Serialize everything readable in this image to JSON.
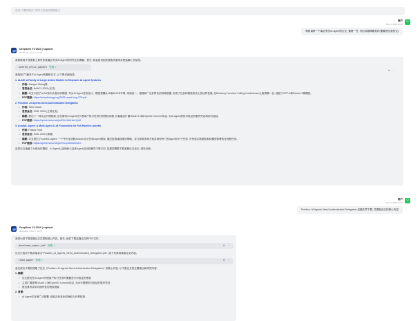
{
  "top_input": {
    "placeholder": "说说, 问题和指令, 按可以在使用搜索能力"
  },
  "conversation": {
    "user1": {
      "name": "用户",
      "time": "Nov 3, 2025 11:24",
      "message": "帮我调研一下最近有关AI agent的论文, 要看一些, 列出标题摘要就好(需要提交我的论)"
    },
    "ai1": {
      "name": "DeepSeek V3 0324 | sophnet",
      "time": "deepseek • Nov 3, 11:24",
      "intro": "我将使用开放搜索工具来查找最近有关AI Agent的研究论文摘要。首先, 我会尝试相关搜索关键词并把结果汇总给您。",
      "tool": {
        "name": "search_arxiv_papers",
        "status": "完成 ✓"
      },
      "results_intro": "我找到了3篇关于AI Agent的最新论文, 以下是详细信息:",
      "papers": [
        {
          "title": "1. aLAM: A Family of Large Action Models to Empower AI Agent Systems",
          "author_label": "作者:",
          "author": "Jianguo Zhang等",
          "venue_label": "发表会议:",
          "venue": "NAACL 2025 (长文)",
          "abstract_label": "摘要:",
          "abstract": "本文介绍了xLAM系列大型动作模型, 专为AI Agent任务设计。模型规模从1B到8x22B不等, 采用统一、增强和广泛多样化的训练数据, 实现了在多种基准测试上的优异性能, 在Berkeley Function-Calling Leaderboard上取得第一名, 超越了GPT-4和Claude-3等模型。",
          "link_label": "PDF链接:",
          "link": "https://aclanthology.org/2025.naacl-long.378.pdf"
        },
        {
          "title": "2. Position: AI Agents Need Authenticated Delegation",
          "author_label": "作者:",
          "author": "Tobin South",
          "venue_label": "发表会议:",
          "venue": "ICML 2025 (立场论文)",
          "abstract_label": "摘要:",
          "abstract": "提出了一种认证代理框架, 旨在解决AI Agent在代表用户执行任务时的授权问题, 作者建议扩展OAuth 2.0和OpenID Connect协议, 为AI Agent提供可验证的委托凭证和访问控制。",
          "link_label": "PDF链接:",
          "link": "https://openreview.net/pdf?id=9skHxuHyrM"
        },
        {
          "title": "3. AutoML-Agent: A Multi-Agent LLM Framework for Full-Pipeline AutoML",
          "author_label": "作者:",
          "author": "Patara Trirat",
          "venue_label": "发表会议:",
          "venue": "ICML 2025 (海报)",
          "abstract_label": "摘要:",
          "abstract": "本文提出了AutoML-Agent, 一个专为全流程AutoML设计的多Agent框架, 通过检索增强规划策略、并行探索多种方案并使用专门的Agent执行子任务, 可完成从数据检索到模型部署的全流程任务。",
          "link_label": "PDF链接:",
          "link": "https://openreview.net/pdf?id=p1Bn6rDvZm"
        }
      ],
      "closing": "这些论文涵盖了大型动作模型、AI Agent认证授权以及多Agent自动机器学习等方向, 如果您需要下载某篇论文全文, 请告诉我。"
    },
    "user2": {
      "name": "用户",
      "time": "Nov 3, 2025 11:25",
      "message": "Position: AI Agents Need Authenticated Delegation 这篇文章下载, 并提取出它的核心内容"
    },
    "ai2": {
      "name": "DeepSeek V3 0324 | sophnet",
      "time": "deepseek • Nov 3, 11:25",
      "intro": "我将为您下载这篇论文并提取核心内容。首先, 我们下载这篇论文的PDF文件。",
      "tool1": {
        "name": "download_paper_pdf",
        "status": "完成 ✓"
      },
      "mid": "论文已成功下载并保存为\"Position_AI_Agents_Need_Authenticated_Delegation.pdf\", 接下来我将读取论文内容。",
      "tool2": {
        "name": "read_paper",
        "status": "完成 ✓"
      },
      "summary_intro": "我已成功下载并提取了论文《Position: AI Agents Need Authenticated Delegation》的核心内容, 以下是论文的主要观点和研究内容:",
      "sec1_title": "1. 摘要:",
      "sec1_items": [
        "论文提出在AI Agent代理用户执行任务时需要进行可验证的授权",
        "主张扩展现有OAuth 2.0和OpenID Connect协议, 为AI代理提供可验证的委托凭证",
        "提出具有实际可操作性的授权框架"
      ],
      "sec2_title": "2. 背景:",
      "sec2_items": [
        "AI Agent正在被广泛部署, 但缺乏标准化的授权与问责机制"
      ]
    }
  },
  "icons": {
    "copy": "copy-icon",
    "more": "more-icon"
  }
}
